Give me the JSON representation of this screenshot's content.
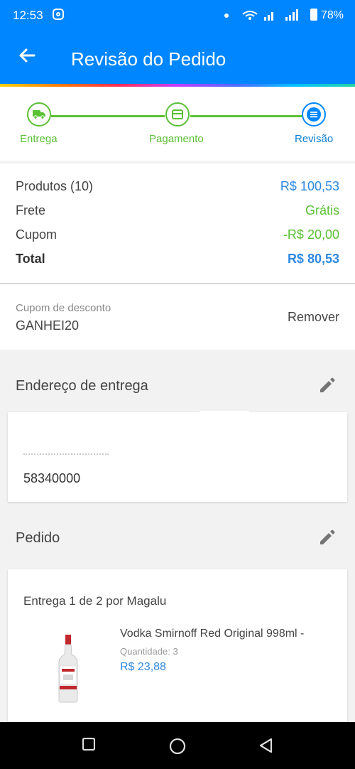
{
  "status_bar": {
    "time": "12:53",
    "network_icons": "4G 4G",
    "battery_pct": "78%"
  },
  "app_bar": {
    "title": "Revisão do Pedido",
    "back_icon": "arrow-left-icon"
  },
  "stepper": {
    "steps": [
      {
        "label": "Entrega",
        "icon": "truck-icon",
        "state": "done"
      },
      {
        "label": "Pagamento",
        "icon": "card-icon",
        "state": "done"
      },
      {
        "label": "Revisão",
        "icon": "list-icon",
        "state": "active"
      }
    ]
  },
  "summary": {
    "products_label": "Produtos (10)",
    "products_value": "R$ 100,53",
    "shipping_label": "Frete",
    "shipping_value": "Grátis",
    "coupon_label": "Cupom",
    "coupon_value": "-R$ 20,00",
    "total_label": "Total",
    "total_value": "R$ 80,53"
  },
  "coupon": {
    "label": "Cupom de desconto",
    "code": "GANHEI20",
    "remove_label": "Remover"
  },
  "address": {
    "title": "Endereço de entrega",
    "cep": "58340000"
  },
  "order": {
    "title": "Pedido",
    "shipment": "Entrega 1 de 2 por Magalu",
    "product_name": "Vodka Smirnoff Red Original 998ml -",
    "quantity_label": "Quantidade:",
    "quantity_value": "3",
    "price": "R$ 23,88"
  },
  "colors": {
    "brand_blue": "#0086ff",
    "green": "#5ac134",
    "price_blue": "#2d89e0"
  }
}
